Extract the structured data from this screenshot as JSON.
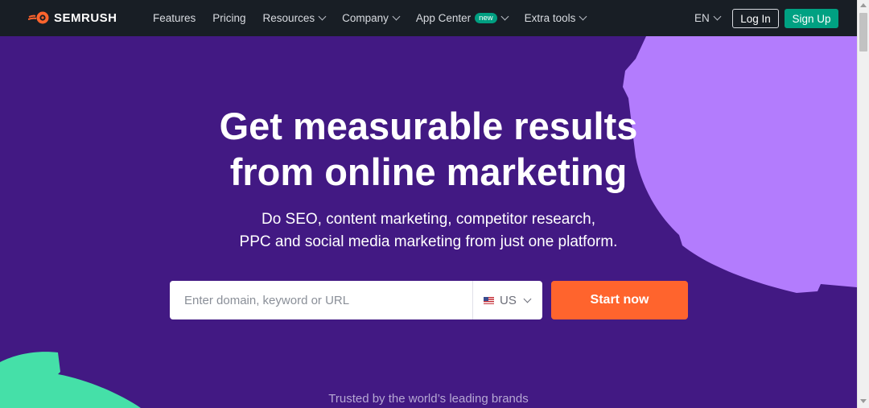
{
  "brand": {
    "name": "SEMRUSH",
    "logo_color": "#ff642d"
  },
  "nav": {
    "items": [
      {
        "label": "Features",
        "has_dropdown": false
      },
      {
        "label": "Pricing",
        "has_dropdown": false
      },
      {
        "label": "Resources",
        "has_dropdown": true
      },
      {
        "label": "Company",
        "has_dropdown": true
      },
      {
        "label": "App Center",
        "has_dropdown": true,
        "badge": "new"
      },
      {
        "label": "Extra tools",
        "has_dropdown": true
      }
    ],
    "language": "EN",
    "login_label": "Log In",
    "signup_label": "Sign Up"
  },
  "hero": {
    "title_line1": "Get measurable results",
    "title_line2": "from online marketing",
    "subtitle_line1": "Do SEO, content marketing, competitor research,",
    "subtitle_line2": "PPC and social media marketing from just one platform.",
    "search_placeholder": "Enter domain, keyword or URL",
    "region": "US",
    "cta_label": "Start now",
    "trusted_text": "Trusted by the world’s leading brands"
  },
  "colors": {
    "background": "#421983",
    "topbar": "#181e25",
    "accent_purple": "#b37cfd",
    "accent_green": "#45e0a8",
    "cta": "#ff642d",
    "signup": "#00a182"
  }
}
